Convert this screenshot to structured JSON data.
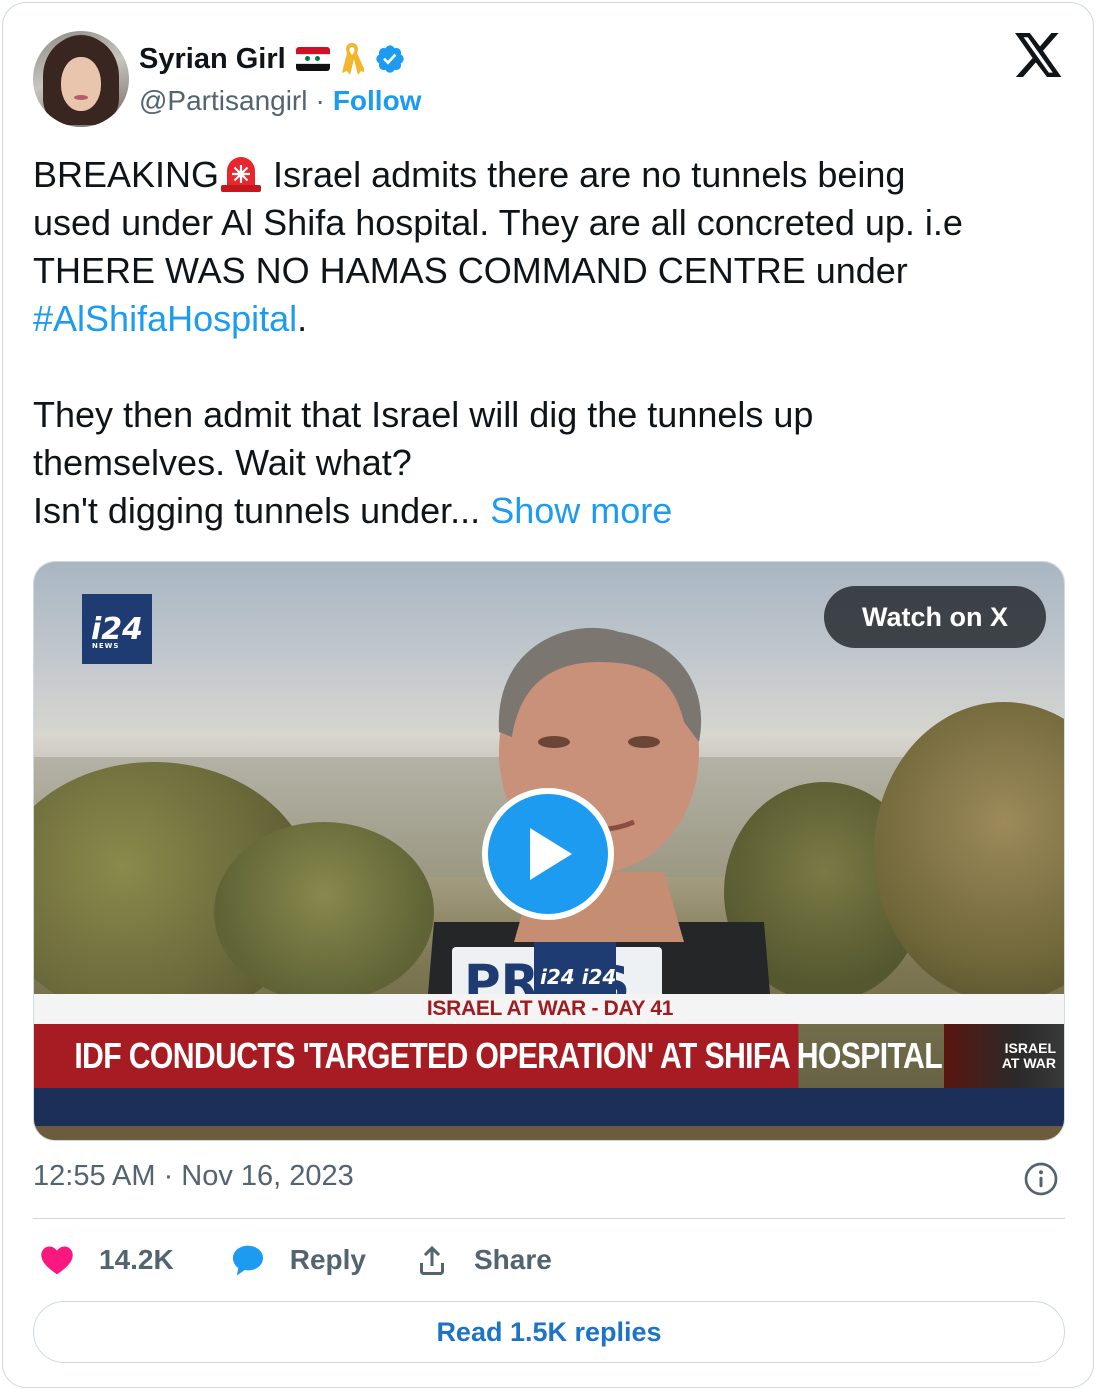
{
  "author": {
    "display_name": "Syrian Girl",
    "handle": "@Partisangirl",
    "separator": "·",
    "follow_label": "Follow",
    "flag_icon": "syria-flag-icon",
    "ribbon_icon": "yellow-ribbon-icon",
    "verified_icon": "verified-badge-icon",
    "verified_color": "#1d9bf0"
  },
  "tweet": {
    "line1_prefix": "BREAKING",
    "line1_suffix": " Israel admits there are no tunnels being",
    "line2": "used under Al Shifa hospital. They are all concreted up. i.e",
    "line3": "THERE WAS NO HAMAS COMMAND CENTRE under",
    "hashtag": "#AlShifaHospital",
    "hashtag_suffix": ".",
    "line5": "They then admit that Israel will dig the tunnels up",
    "line6": "themselves. Wait what?",
    "line7": "Isn't digging tunnels under...",
    "show_more": "Show more",
    "link_color": "#1d9bf0"
  },
  "media": {
    "watch_label": "Watch on X",
    "channel_logo": "i24",
    "channel_logo_sub": "NEWS",
    "ticker_top": "ISRAEL AT WAR - DAY 41",
    "ticker_headline": "IDF CONDUCTS 'TARGETED OPERATION' AT SHIFA HOSPITAL",
    "badge_line1": "ISRAEL",
    "badge_line2": "AT WAR",
    "vest_text": "PRESS"
  },
  "meta": {
    "timestamp": "12:55 AM · Nov 16, 2023"
  },
  "actions": {
    "likes": "14.2K",
    "reply_label": "Reply",
    "share_label": "Share",
    "like_color": "#f91880",
    "reply_color": "#1d9bf0"
  },
  "read_replies": "Read 1.5K replies"
}
